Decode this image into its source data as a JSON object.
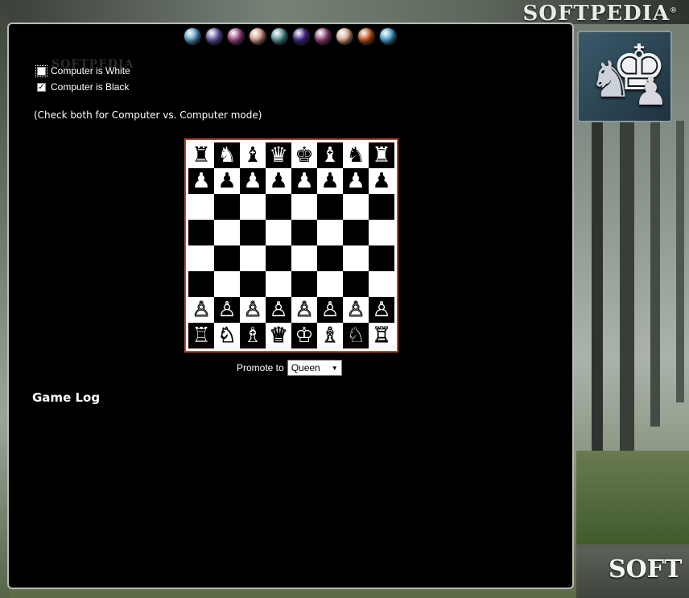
{
  "brand": {
    "top": "SOFTPEDIA",
    "bottom": "SOFT",
    "registered": "®"
  },
  "orbs": [
    {
      "color": "#5aa0c8"
    },
    {
      "color": "#6a5aa8"
    },
    {
      "color": "#a04a88"
    },
    {
      "color": "#d89a8a"
    },
    {
      "color": "#5a9a98"
    },
    {
      "color": "#4a2a98"
    },
    {
      "color": "#9a4a7a"
    },
    {
      "color": "#e0a890"
    },
    {
      "color": "#c85a20"
    },
    {
      "color": "#4aa0d0"
    }
  ],
  "options": {
    "white_label": "Computer is White",
    "white_checked": false,
    "black_label": "Computer is Black",
    "black_checked": true,
    "watermark": "SOFTPEDIA",
    "hint": "(Check both for Computer vs. Computer mode)"
  },
  "board": {
    "ranks": [
      [
        "♜",
        "♞",
        "♝",
        "♛",
        "♚",
        "♝",
        "♞",
        "♜"
      ],
      [
        "♟",
        "♟",
        "♟",
        "♟",
        "♟",
        "♟",
        "♟",
        "♟"
      ],
      [
        "",
        "",
        "",
        "",
        "",
        "",
        "",
        ""
      ],
      [
        "",
        "",
        "",
        "",
        "",
        "",
        "",
        ""
      ],
      [
        "",
        "",
        "",
        "",
        "",
        "",
        "",
        ""
      ],
      [
        "",
        "",
        "",
        "",
        "",
        "",
        "",
        ""
      ],
      [
        "♙",
        "♙",
        "♙",
        "♙",
        "♙",
        "♙",
        "♙",
        "♙"
      ],
      [
        "♖",
        "♘",
        "♗",
        "♕",
        "♔",
        "♗",
        "♘",
        "♖"
      ]
    ],
    "border_color": "#b84a2a"
  },
  "promote": {
    "label": "Promote to",
    "selected": "Queen"
  },
  "log": {
    "title": "Game Log"
  }
}
